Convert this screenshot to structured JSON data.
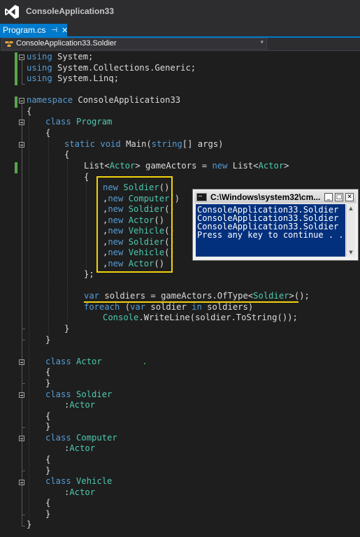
{
  "window": {
    "title": "ConsoleApplication33"
  },
  "tab": {
    "label": "Program.cs",
    "pin_glyph": "⊣",
    "close_glyph": "✕"
  },
  "navbar": {
    "member": "ConsoleApplication33.Soldier",
    "icon": "class-icon",
    "dropdown_glyph": "▾"
  },
  "code": {
    "l1": [
      "using",
      " System;"
    ],
    "l2": [
      "using",
      " System.Collections.Generic;"
    ],
    "l3": [
      "using",
      " System.Linq;"
    ],
    "l5": [
      "namespace",
      " ConsoleApplication33"
    ],
    "l6": "{",
    "l7": [
      "class",
      "Program"
    ],
    "l8": "{",
    "l9": [
      "static",
      "void",
      " Main(",
      "string",
      "[] args)"
    ],
    "l10": "{",
    "l11": [
      "List<",
      "Actor",
      "> gameActors = ",
      "new",
      " List<",
      "Actor",
      ">"
    ],
    "l12": "{",
    "l13": [
      [
        "",
        "new",
        "Soldier",
        "()"
      ],
      [
        ",",
        "new",
        "Computer",
        "()"
      ],
      [
        ",",
        "new",
        "Soldier",
        "()"
      ],
      [
        ",",
        "new",
        "Actor",
        "()"
      ],
      [
        ",",
        "new",
        "Vehicle",
        "()"
      ],
      [
        ",",
        "new",
        "Soldier",
        "()"
      ],
      [
        ",",
        "new",
        "Vehicle",
        "()"
      ],
      [
        ",",
        "new",
        "Actor",
        "()"
      ]
    ],
    "l21": "};",
    "l23": [
      "var",
      " soldiers = gameActors.OfType<",
      "Soldier",
      ">();"
    ],
    "l24": [
      "foreach",
      " (",
      "var",
      " soldier ",
      "in",
      " soldiers)"
    ],
    "l25": [
      "Console",
      ".WriteLine(soldier.ToString());"
    ],
    "l26": "}",
    "l27": "}",
    "l29": [
      "class",
      "Actor"
    ],
    "l30": "{",
    "l31": "}",
    "l32": [
      "class",
      "Soldier"
    ],
    "l33": [
      ":",
      "Actor"
    ],
    "l34": "{",
    "l35": "}",
    "l36": [
      "class",
      "Computer"
    ],
    "l37": [
      ":",
      "Actor"
    ],
    "l38": "{",
    "l39": "}",
    "l40": [
      "class",
      "Vehicle"
    ],
    "l41": [
      ":",
      "Actor"
    ],
    "l42": "{",
    "l43": "}",
    "l44": "}"
  },
  "console": {
    "title": "C:\\Windows\\system32\\cm...",
    "lines": [
      "ConsoleApplication33.Soldier",
      "ConsoleApplication33.Soldier",
      "ConsoleApplication33.Soldier",
      "Press any key to continue . . ."
    ],
    "buttons": {
      "minimize": "_",
      "maximize": "□",
      "close": "✕"
    },
    "scroll_up": "▲",
    "scroll_down": "▼"
  },
  "colors": {
    "keyword": "#569cd6",
    "type": "#4ec9b0",
    "text": "#dcdcdc",
    "highlight": "#f2d20b",
    "accent": "#007acc",
    "console_bg": "#03307d"
  }
}
